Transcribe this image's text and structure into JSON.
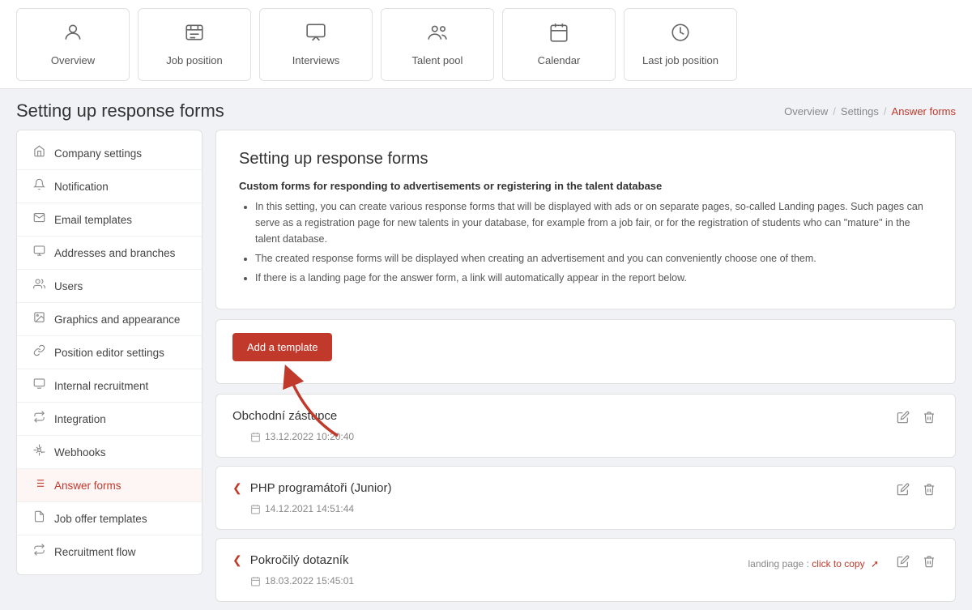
{
  "topnav": {
    "items": [
      {
        "id": "overview",
        "label": "Overview",
        "icon": "⌂"
      },
      {
        "id": "job-position",
        "label": "Job position",
        "icon": "≡"
      },
      {
        "id": "interviews",
        "label": "Interviews",
        "icon": "◫"
      },
      {
        "id": "talent-pool",
        "label": "Talent pool",
        "icon": "👤"
      },
      {
        "id": "calendar",
        "label": "Calendar",
        "icon": "📅"
      },
      {
        "id": "last-job-position",
        "label": "Last job position",
        "icon": "🕐"
      }
    ]
  },
  "breadcrumb": {
    "overview": "Overview",
    "settings": "Settings",
    "active": "Answer forms"
  },
  "page": {
    "title": "Setting up response forms"
  },
  "sidebar": {
    "items": [
      {
        "id": "company-settings",
        "label": "Company settings",
        "icon": "⌂"
      },
      {
        "id": "notification",
        "label": "Notification",
        "icon": "🔔"
      },
      {
        "id": "email-templates",
        "label": "Email templates",
        "icon": "✉"
      },
      {
        "id": "addresses-branches",
        "label": "Addresses and branches",
        "icon": "◫"
      },
      {
        "id": "users",
        "label": "Users",
        "icon": "👥"
      },
      {
        "id": "graphics-appearance",
        "label": "Graphics and appearance",
        "icon": "🖼"
      },
      {
        "id": "position-editor",
        "label": "Position editor settings",
        "icon": "🔗"
      },
      {
        "id": "internal-recruitment",
        "label": "Internal recruitment",
        "icon": "◫"
      },
      {
        "id": "integration",
        "label": "Integration",
        "icon": "⇄"
      },
      {
        "id": "webhooks",
        "label": "Webhooks",
        "icon": "🤖"
      },
      {
        "id": "answer-forms",
        "label": "Answer forms",
        "icon": "≡",
        "active": true
      },
      {
        "id": "job-offer-templates",
        "label": "Job offer templates",
        "icon": "📄"
      },
      {
        "id": "recruitment-flow",
        "label": "Recruitment flow",
        "icon": "⇄"
      }
    ]
  },
  "content": {
    "title": "Setting up response forms",
    "subtitle": "Custom forms for responding to advertisements or registering in the talent database",
    "bullets": [
      "In this setting, you can create various response forms that will be displayed with ads or on separate pages, so-called Landing pages. Such pages can serve as a registration page for new talents in your database, for example from a job fair, or for the registration of students who can \"mature\" in the talent database.",
      "The created response forms will be displayed when creating an advertisement and you can conveniently choose one of them.",
      "If there is a landing page for the answer form, a link will automatically appear in the report below."
    ],
    "add_button": "Add a template"
  },
  "templates": [
    {
      "id": "1",
      "name": "Obchodní zástupce",
      "date": "13.12.2022 10:20:40",
      "has_chevron": false,
      "landing_page": null
    },
    {
      "id": "2",
      "name": "PHP programátoři (Junior)",
      "date": "14.12.2021 14:51:44",
      "has_chevron": true,
      "landing_page": null
    },
    {
      "id": "3",
      "name": "Pokročilý dotazník",
      "date": "18.03.2022 15:45:01",
      "has_chevron": true,
      "landing_page": "landing page : click to copy"
    }
  ]
}
